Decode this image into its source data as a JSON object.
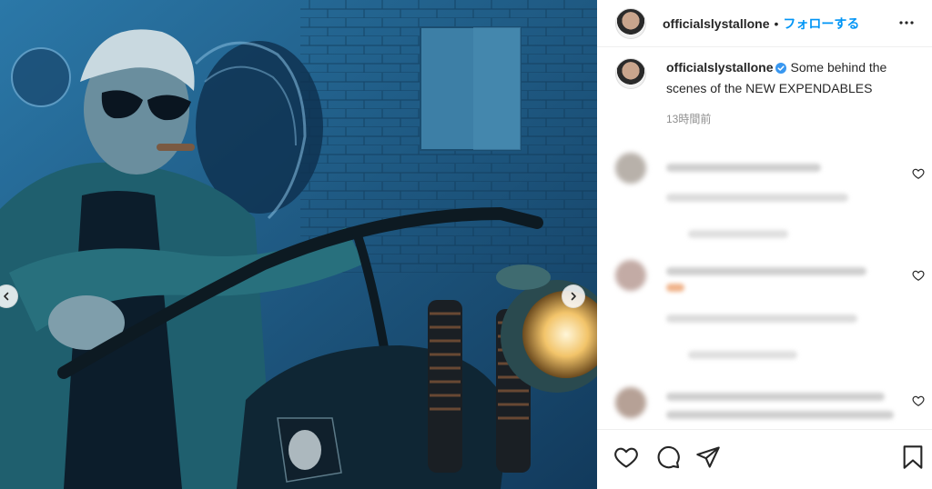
{
  "post": {
    "username": "officialslystallone",
    "follow_label": "フォローする",
    "separator": "•",
    "caption": "Some behind the scenes of the NEW EXPENDABLES",
    "time_ago": "13時間前"
  },
  "icons": {
    "more": "more-options-icon",
    "verified": "verified-badge-icon",
    "like": "heart-icon",
    "comment": "comment-icon",
    "share": "send-icon",
    "save": "bookmark-icon",
    "carousel_prev": "chevron-left-icon",
    "carousel_next": "chevron-right-icon"
  },
  "colors": {
    "accent": "#0095f6",
    "text": "#262626",
    "muted": "#8e8e8e",
    "border": "#efefef"
  }
}
